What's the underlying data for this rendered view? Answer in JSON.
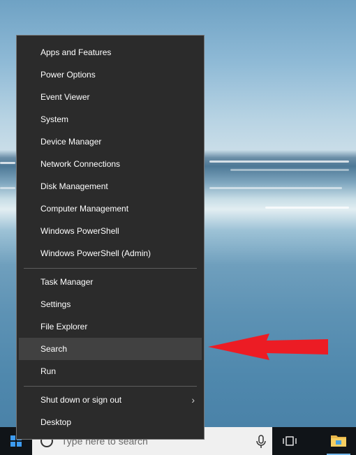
{
  "menu": {
    "group1": [
      {
        "label": "Apps and Features"
      },
      {
        "label": "Power Options"
      },
      {
        "label": "Event Viewer"
      },
      {
        "label": "System"
      },
      {
        "label": "Device Manager"
      },
      {
        "label": "Network Connections"
      },
      {
        "label": "Disk Management"
      },
      {
        "label": "Computer Management"
      },
      {
        "label": "Windows PowerShell"
      },
      {
        "label": "Windows PowerShell (Admin)"
      }
    ],
    "group2": [
      {
        "label": "Task Manager"
      },
      {
        "label": "Settings"
      },
      {
        "label": "File Explorer"
      },
      {
        "label": "Search"
      },
      {
        "label": "Run"
      }
    ],
    "group3": [
      {
        "label": "Shut down or sign out"
      },
      {
        "label": "Desktop"
      }
    ],
    "highlighted_item": "Search"
  },
  "taskbar": {
    "search_placeholder": "Type here to search"
  },
  "colors": {
    "menu_bg": "#2b2b2b",
    "menu_hover": "#414141",
    "arrow": "#ec1c24",
    "start_logo": "#3d9bf0"
  },
  "icons": [
    "windows-logo-icon",
    "cortana-circle-icon",
    "microphone-icon",
    "task-view-icon",
    "file-explorer-icon",
    "chevron-right-icon",
    "red-arrow-annotation"
  ]
}
